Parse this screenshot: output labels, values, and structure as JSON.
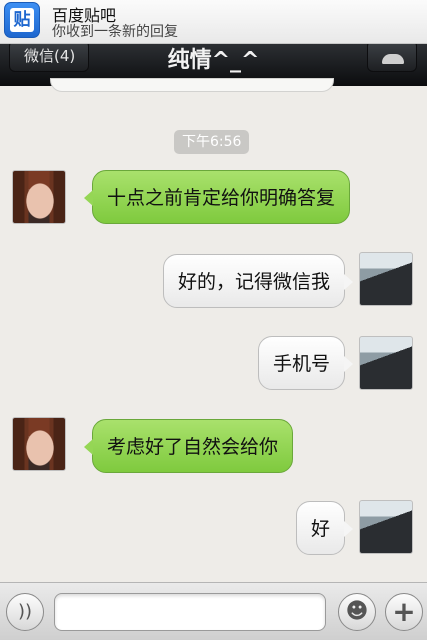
{
  "notification": {
    "app_icon_char": "贴",
    "title": "百度贴吧",
    "message": "你收到一条新的回复"
  },
  "navbar": {
    "back_label": "微信(4)",
    "title": "纯情^_^"
  },
  "chat": {
    "time_label": "下午6:56",
    "messages": [
      {
        "side": "left",
        "text": "十点之前肯定给你明确答复"
      },
      {
        "side": "right",
        "text": "好的，记得微信我"
      },
      {
        "side": "right",
        "text": "手机号"
      },
      {
        "side": "left",
        "text": "考虑好了自然会给你"
      },
      {
        "side": "right",
        "text": "好"
      }
    ]
  },
  "toolbar": {
    "input_value": "",
    "voice_icon": "voice-icon",
    "emoji_icon": "emoji-icon",
    "plus_icon": "plus-icon"
  },
  "colors": {
    "incoming_bubble": "#95d655",
    "outgoing_bubble": "#f5f5f5",
    "navbar": "#1b1d20"
  }
}
